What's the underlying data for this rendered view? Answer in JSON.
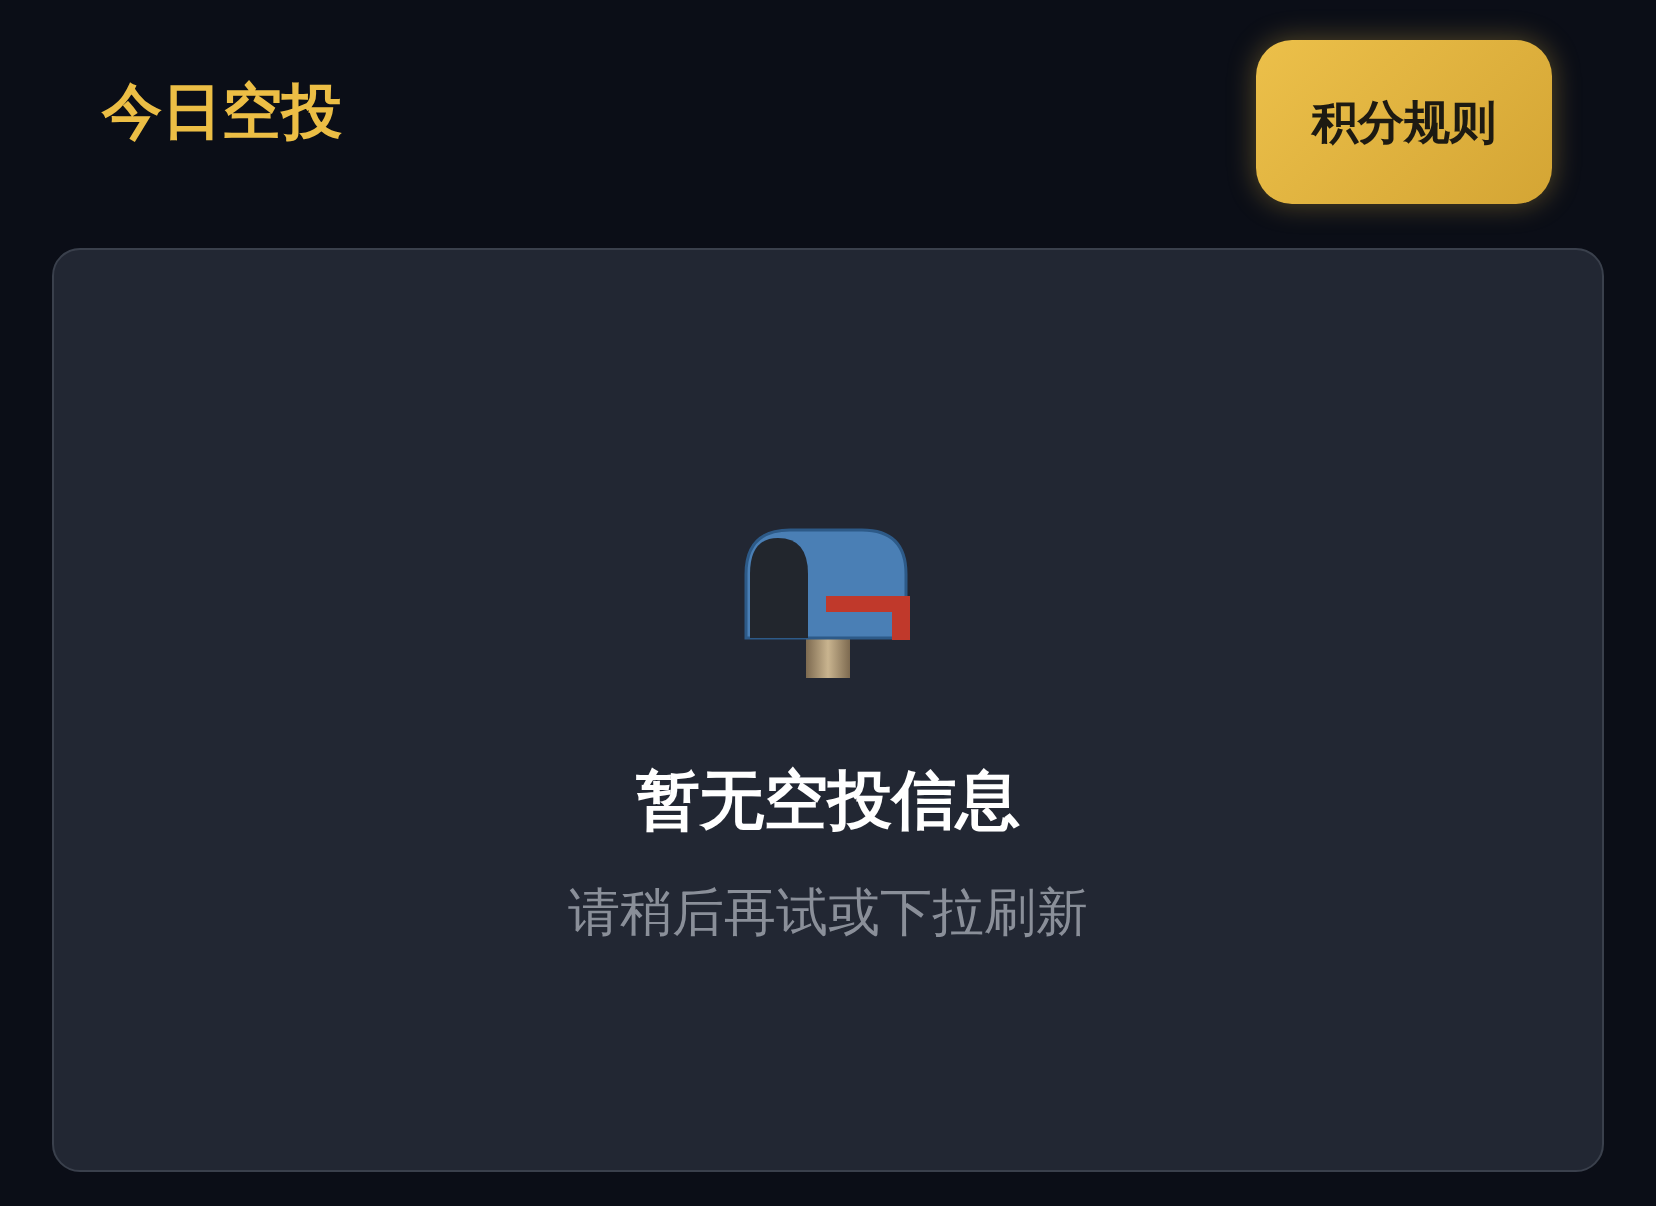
{
  "header": {
    "title": "今日空投",
    "rules_button": "积分规则"
  },
  "empty_state": {
    "title": "暂无空投信息",
    "hint": "请稍后再试或下拉刷新"
  }
}
